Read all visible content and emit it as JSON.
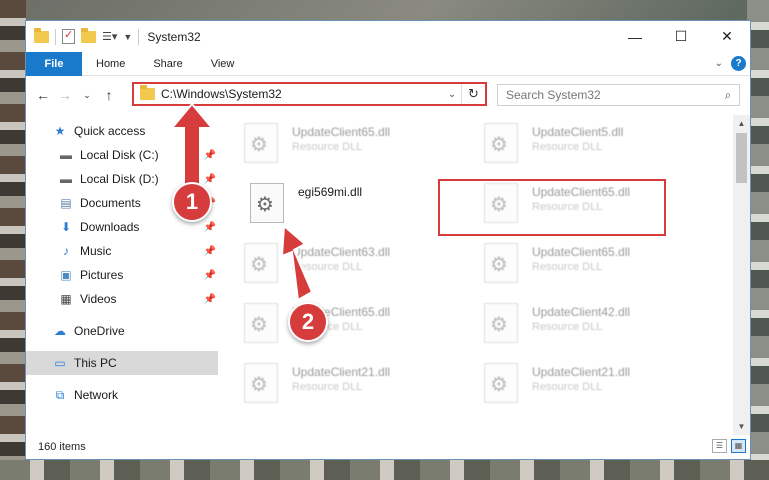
{
  "window": {
    "title": "System32",
    "controls": {
      "minimize": "—",
      "maximize": "☐",
      "close": "✕"
    }
  },
  "ribbon": {
    "tabs": [
      "File",
      "Home",
      "Share",
      "View"
    ]
  },
  "navigation": {
    "address": "C:\\Windows\\System32",
    "search_placeholder": "Search System32"
  },
  "sidebar": {
    "items": [
      {
        "label": "Quick access",
        "icon": "star-icon",
        "pinned": false
      },
      {
        "label": "Local Disk (C:)",
        "icon": "drive-icon",
        "pinned": true
      },
      {
        "label": "Local Disk (D:)",
        "icon": "drive-icon",
        "pinned": true
      },
      {
        "label": "Documents",
        "icon": "documents-icon",
        "pinned": true
      },
      {
        "label": "Downloads",
        "icon": "download-icon",
        "pinned": true
      },
      {
        "label": "Music",
        "icon": "music-icon",
        "pinned": true
      },
      {
        "label": "Pictures",
        "icon": "pictures-icon",
        "pinned": true
      },
      {
        "label": "Videos",
        "icon": "videos-icon",
        "pinned": true
      },
      {
        "label": "OneDrive",
        "icon": "cloud-icon",
        "pinned": false
      },
      {
        "label": "This PC",
        "icon": "computer-icon",
        "pinned": false,
        "selected": true
      },
      {
        "label": "Network",
        "icon": "network-icon",
        "pinned": false
      }
    ]
  },
  "files": [
    {
      "name": "UpdateClient65.dll",
      "type": "Resource DLL"
    },
    {
      "name": "UpdateClient5.dll",
      "type": "Resource DLL"
    },
    {
      "name": "egi569mi.dll",
      "type": ""
    },
    {
      "name": "UpdateClient65.dll",
      "type": "Resource DLL"
    },
    {
      "name": "UpdateClient63.dll",
      "type": "Resource DLL"
    },
    {
      "name": "UpdateClient65.dll",
      "type": "Resource DLL"
    },
    {
      "name": "UpdateClient65.dll",
      "type": "Resource DLL"
    },
    {
      "name": "UpdateClient42.dll",
      "type": "Resource DLL"
    },
    {
      "name": "UpdateClient21.dll",
      "type": "Resource DLL"
    },
    {
      "name": "UpdateClient21.dll",
      "type": "Resource DLL"
    }
  ],
  "status": {
    "item_count": "160 items"
  },
  "annotations": {
    "step1": "1",
    "step2": "2",
    "color": "#d63c3c"
  },
  "colors": {
    "accent": "#1979ca",
    "highlight": "#d63c3c"
  }
}
